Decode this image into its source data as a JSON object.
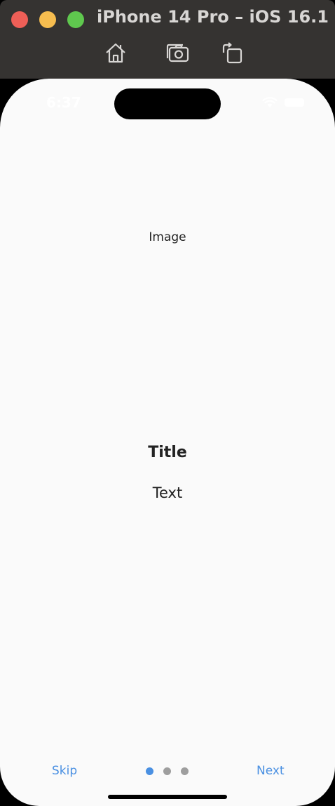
{
  "window": {
    "title": "iPhone 14 Pro – iOS 16.1",
    "toolbar": [
      {
        "icon": "home-icon"
      },
      {
        "icon": "screenshot-icon"
      },
      {
        "icon": "rotate-icon"
      }
    ]
  },
  "status_bar": {
    "time": "6:37",
    "icons": [
      "wifi-icon",
      "battery-icon"
    ]
  },
  "content": {
    "image_placeholder": "Image",
    "title": "Title",
    "text": "Text"
  },
  "footer": {
    "skip_label": "Skip",
    "next_label": "Next",
    "page_indicator": {
      "current": 1,
      "total": 3
    }
  },
  "colors": {
    "accent": "#4a90e2",
    "dot_inactive": "#9e9e9e",
    "background": "#fafafa",
    "titlebar": "#353331"
  }
}
